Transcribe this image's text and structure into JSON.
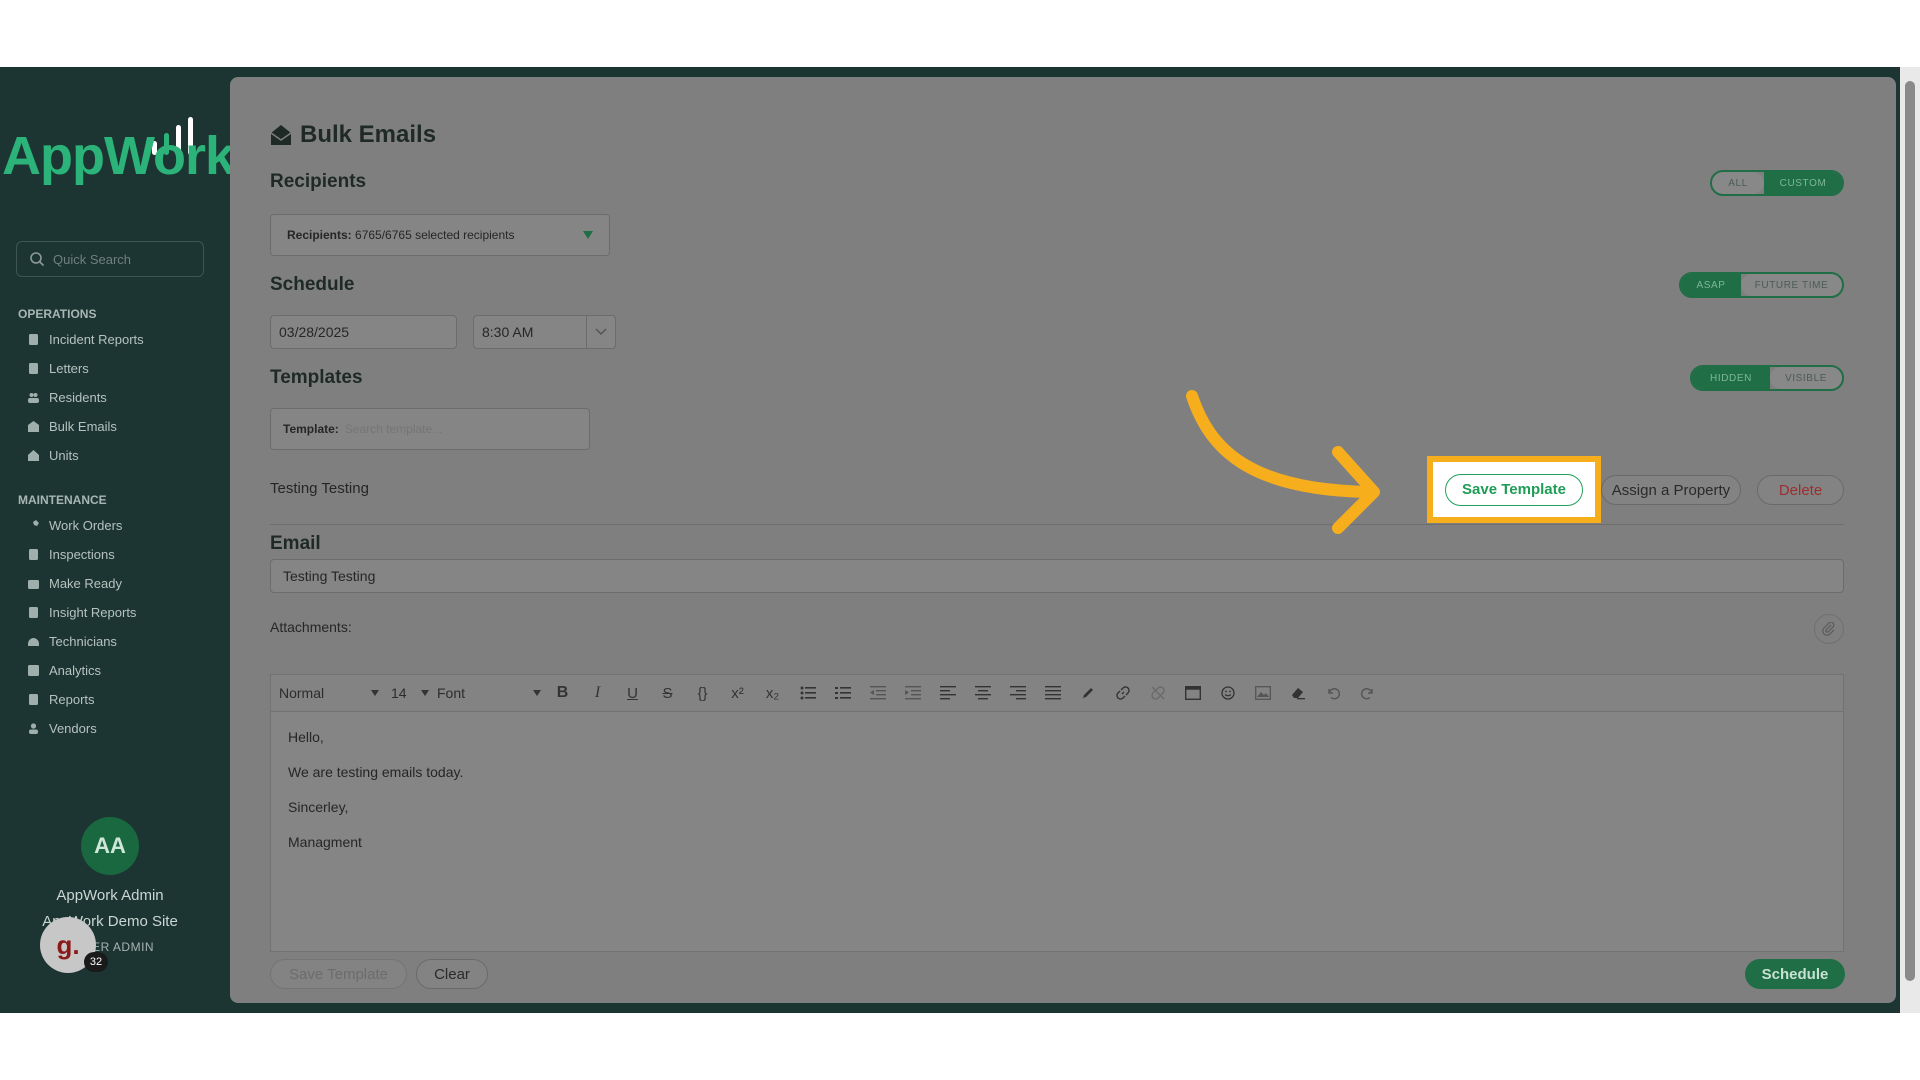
{
  "sidebar": {
    "logo": "AppWork",
    "search_placeholder": "Quick Search",
    "sections": [
      {
        "title": "OPERATIONS",
        "items": [
          {
            "label": "Incident Reports",
            "icon": "document-icon"
          },
          {
            "label": "Letters",
            "icon": "document-icon"
          },
          {
            "label": "Residents",
            "icon": "users-icon"
          },
          {
            "label": "Bulk Emails",
            "icon": "envelope-icon"
          },
          {
            "label": "Units",
            "icon": "home-icon"
          }
        ]
      },
      {
        "title": "MAINTENANCE",
        "items": [
          {
            "label": "Work Orders",
            "icon": "wrench-icon"
          },
          {
            "label": "Inspections",
            "icon": "document-icon"
          },
          {
            "label": "Make Ready",
            "icon": "box-icon"
          },
          {
            "label": "Insight Reports",
            "icon": "document-icon"
          },
          {
            "label": "Technicians",
            "icon": "helmet-icon"
          },
          {
            "label": "Analytics",
            "icon": "chart-icon"
          },
          {
            "label": "Reports",
            "icon": "document-icon"
          },
          {
            "label": "Vendors",
            "icon": "user-icon"
          }
        ]
      }
    ],
    "user": {
      "initials": "AA",
      "name": "AppWork Admin",
      "site": "AppWork Demo Site",
      "role": "SUPER ADMIN"
    },
    "badge_letter": "g.",
    "badge_count": "32"
  },
  "main": {
    "title": "Bulk Emails",
    "recipients": {
      "heading": "Recipients",
      "toggle": [
        "ALL",
        "CUSTOM"
      ],
      "field_label": "Recipients:",
      "field_value": "6765/6765 selected recipients"
    },
    "schedule": {
      "heading": "Schedule",
      "toggle": [
        "ASAP",
        "FUTURE TIME"
      ],
      "date": "03/28/2025",
      "time": "8:30 AM"
    },
    "templates": {
      "heading": "Templates",
      "toggle": [
        "HIDDEN",
        "VISIBLE"
      ],
      "field_label": "Template:",
      "placeholder": "Search template...",
      "current_name": "Testing Testing",
      "save_label": "Save Template",
      "assign_label": "Assign a Property",
      "delete_label": "Delete"
    },
    "email": {
      "heading": "Email",
      "subject": "Testing Testing",
      "attachments_label": "Attachments:",
      "toolbar": {
        "style": "Normal",
        "size": "14",
        "font": "Font"
      },
      "body": [
        "Hello,",
        "We are testing emails today.",
        "Sincerley,",
        "Managment"
      ]
    },
    "footer": {
      "save_label": "Save Template",
      "clear_label": "Clear",
      "schedule_label": "Schedule"
    }
  },
  "colors": {
    "sidebar_bg": "#1c3532",
    "brand_green": "#2bb37a",
    "highlight": "#f7ae1c",
    "danger": "#c0392b"
  }
}
